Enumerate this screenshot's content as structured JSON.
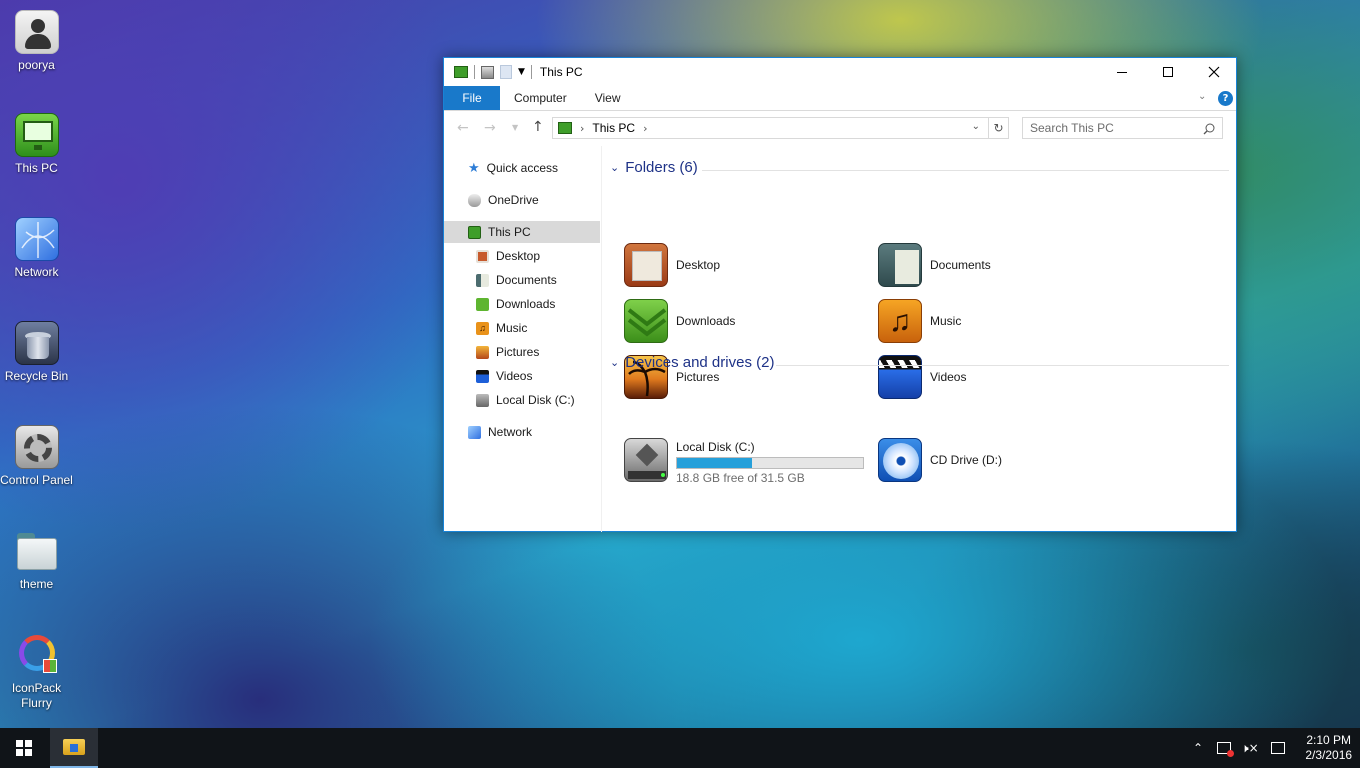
{
  "desktop_icons": [
    {
      "label": "poorya",
      "icon": "user-icon"
    },
    {
      "label": "This PC",
      "icon": "monitor-icon"
    },
    {
      "label": "Network",
      "icon": "network-icon"
    },
    {
      "label": "Recycle Bin",
      "icon": "recycle-bin-icon"
    },
    {
      "label": "Control Panel",
      "icon": "control-panel-icon"
    },
    {
      "label": "theme",
      "icon": "folder-icon"
    },
    {
      "label": "IconPack Flurry",
      "icon": "iconpack-icon"
    }
  ],
  "window": {
    "title": "This PC",
    "tabs": {
      "file": "File",
      "computer": "Computer",
      "view": "View"
    },
    "address": {
      "location": "This PC"
    },
    "search": {
      "placeholder": "Search This PC"
    }
  },
  "nav_pane": {
    "quick_access": "Quick access",
    "onedrive": "OneDrive",
    "this_pc": "This PC",
    "children": [
      "Desktop",
      "Documents",
      "Downloads",
      "Music",
      "Pictures",
      "Videos",
      "Local Disk (C:)"
    ],
    "network": "Network"
  },
  "folders": {
    "header": "Folders (6)",
    "items": [
      "Desktop",
      "Documents",
      "Downloads",
      "Music",
      "Pictures",
      "Videos"
    ]
  },
  "devices": {
    "header": "Devices and drives (2)",
    "local_disk": {
      "name": "Local Disk (C:)",
      "free_text": "18.8 GB free of 31.5 GB",
      "used_fraction": 0.403
    },
    "cd_drive": {
      "name": "CD Drive (D:)"
    }
  },
  "taskbar": {
    "time": "2:10 PM",
    "date": "2/3/2016"
  },
  "colors": {
    "accent": "#1979ca",
    "header_blue": "#1e3287",
    "taskbar": "#101418",
    "progress": "#26a0da"
  }
}
